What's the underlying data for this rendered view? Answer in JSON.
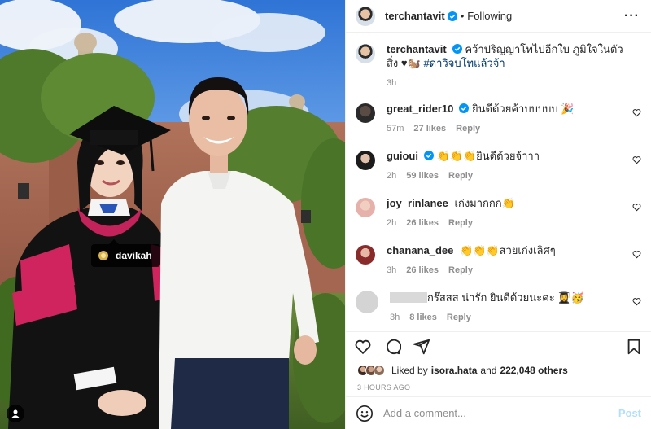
{
  "post": {
    "author": "terchantavit",
    "following_label": "Following",
    "more_icon": "more-horizontal-icon",
    "photo_tag": "davikah",
    "caption": {
      "username": "terchantavit",
      "text": "คว้าปริญญาโทไปอีกใบ ภูมิใจในตัวสิ่ง ♥︎🐿️",
      "hashtag": "#ดาวิจบโทแล้วจ้า",
      "time": "3h"
    }
  },
  "comments": [
    {
      "username": "great_rider10",
      "verified": true,
      "text": "ยินดีด้วยค้าบบบบบ 🎉",
      "time": "57m",
      "likes": "27 likes",
      "reply": "Reply",
      "avatar_color": "#3b3b3b"
    },
    {
      "username": "guioui",
      "verified": true,
      "text": "👏👏👏ยินดีด้วยจ้าาา",
      "time": "2h",
      "likes": "59 likes",
      "reply": "Reply",
      "avatar_color": "#2a2a2a"
    },
    {
      "username": "joy_rinlanee",
      "verified": false,
      "text": "เก่งมากกก👏",
      "time": "2h",
      "likes": "26 likes",
      "reply": "Reply",
      "avatar_color": "#e7b7b0"
    },
    {
      "username": "chanana_dee",
      "verified": false,
      "text": "👏👏👏สวยเก่งเลิศๆ",
      "time": "3h",
      "likes": "26 likes",
      "reply": "Reply",
      "avatar_color": "#8a2b2b"
    },
    {
      "username": "",
      "verified": false,
      "text": "กร๊สสส น่ารัก ยินดีด้วยนะคะ 👩‍🎓🥳",
      "time": "3h",
      "likes": "8 likes",
      "reply": "Reply",
      "avatar_color": "#d4d4d4"
    }
  ],
  "likes_summary": {
    "prefix": "Liked by",
    "user": "isora.hata",
    "joiner": "and",
    "others": "222,048 others"
  },
  "time_ago": "3 HOURS AGO",
  "comment_box": {
    "placeholder": "Add a comment...",
    "post_label": "Post"
  },
  "colors": {
    "verified": "#0095f6",
    "post_disabled": "#b2dffc",
    "muted": "#8e8e8e",
    "hashtag": "#00376b"
  }
}
